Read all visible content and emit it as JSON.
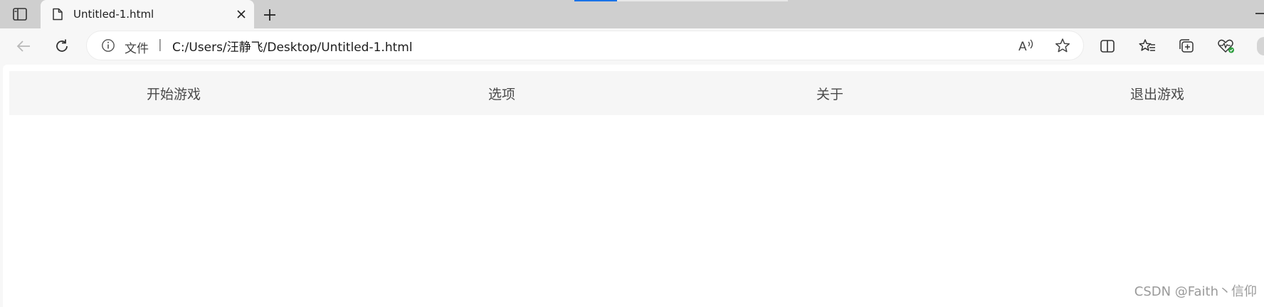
{
  "browser": {
    "tab": {
      "title": "Untitled-1.html"
    },
    "address_bar": {
      "scheme_label": "文件",
      "separator": "|",
      "url": "C:/Users/汪静飞/Desktop/Untitled-1.html"
    }
  },
  "page": {
    "menu": {
      "items": [
        {
          "label": "开始游戏"
        },
        {
          "label": "选项"
        },
        {
          "label": "关于"
        },
        {
          "label": "退出游戏"
        }
      ]
    },
    "watermark": "CSDN @Faith丶信仰"
  },
  "icons": {
    "sidebar_toggle": "sidebar-icon",
    "tab_favicon": "document-icon",
    "tab_close": "close-icon",
    "new_tab": "plus-icon",
    "back": "back-arrow-icon",
    "reload": "reload-icon",
    "site_info": "info-icon",
    "read_aloud": "read-aloud-icon",
    "favorite": "star-icon",
    "split_screen": "split-screen-icon",
    "favorites": "favorites-icon",
    "collections": "collections-icon",
    "browser_essentials": "heart-pulse-icon"
  }
}
